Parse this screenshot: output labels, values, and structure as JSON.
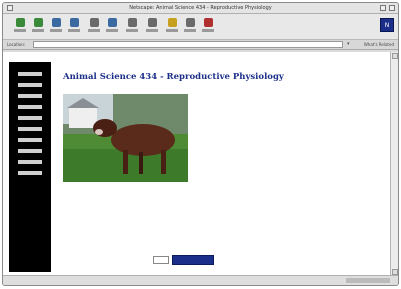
{
  "window": {
    "title": "Netscape: Animal Science 434 - Reproductive Physiology"
  },
  "toolbar": {
    "buttons": [
      {
        "icon": "back-icon",
        "color": "#3a8a3a"
      },
      {
        "icon": "forward-icon",
        "color": "#3a8a3a"
      },
      {
        "icon": "reload-icon",
        "color": "#3a6aa0"
      },
      {
        "icon": "home-icon",
        "color": "#3a6aa0"
      },
      {
        "icon": "search-icon",
        "color": "#6a6a6a"
      },
      {
        "icon": "netscape-icon",
        "color": "#3a6aa0"
      },
      {
        "icon": "images-icon",
        "color": "#6a6a6a"
      },
      {
        "icon": "print-icon",
        "color": "#6a6a6a"
      },
      {
        "icon": "security-icon",
        "color": "#c8a020"
      },
      {
        "icon": "shop-icon",
        "color": "#6a6a6a"
      },
      {
        "icon": "stop-icon",
        "color": "#b03030"
      }
    ],
    "brand_letter": "N"
  },
  "location": {
    "label": "Location:",
    "related_label": "What's Related"
  },
  "nav": {
    "items": [
      "",
      "",
      "",
      "",
      "",
      "",
      "",
      "",
      "",
      ""
    ]
  },
  "page": {
    "title": "Animal Science 434 - Reproductive Physiology",
    "info_lines": [
      "",
      "",
      "",
      "",
      "",
      ""
    ],
    "search_label": "",
    "search_button": "",
    "footer_warning": "",
    "footer_text": ""
  },
  "status": {
    "text": ""
  }
}
